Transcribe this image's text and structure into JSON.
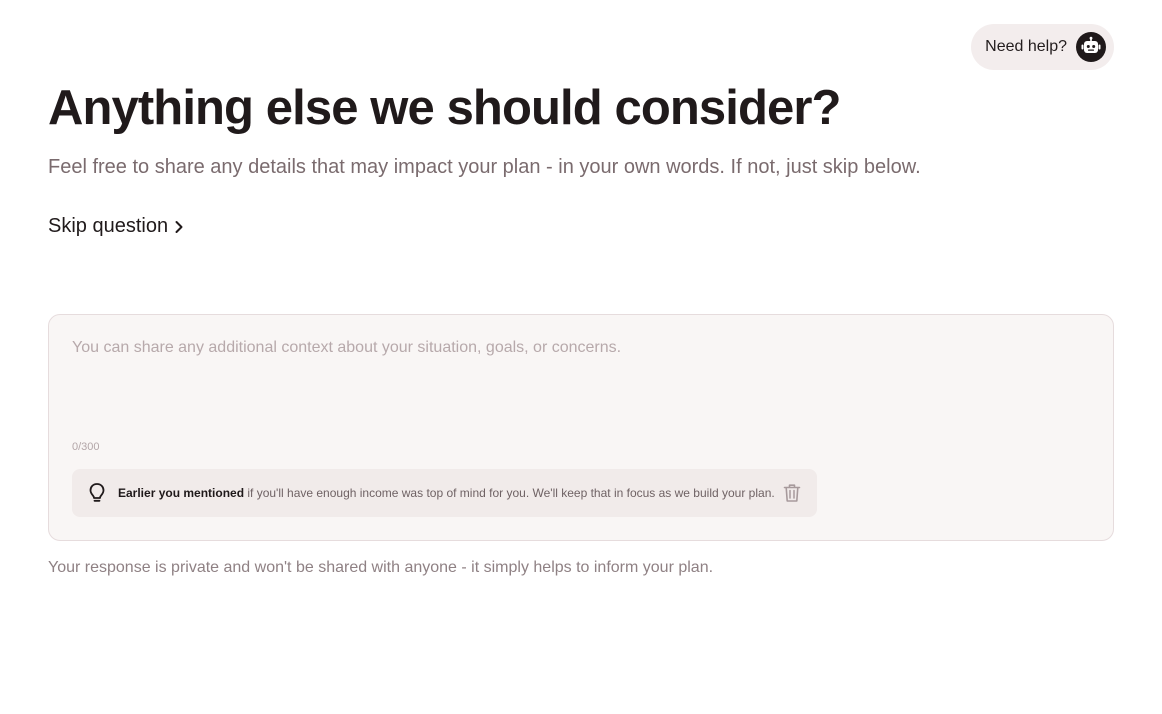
{
  "help": {
    "label": "Need help?",
    "icon": "robot-icon"
  },
  "question": {
    "title": "Anything else we should consider?",
    "subtitle": "Feel free to share any details that may impact your plan - in your own words. If not, just skip below."
  },
  "skip": {
    "label": "Skip question",
    "icon": "chevron-right-icon"
  },
  "response": {
    "value": "",
    "placeholder": "You can share any additional context about your situation, goals, or concerns.",
    "counter": "0/300"
  },
  "mention": {
    "icon": "lightbulb-icon",
    "prefix": "Earlier you mentioned",
    "text": "if you'll have enough income was top of mind for you. We'll keep that in focus as we build your plan.",
    "delete_icon": "trash-icon"
  },
  "privacy_note": "Your response is private and won't be shared with anyone - it simply helps to inform your plan.",
  "colors": {
    "text_primary": "#201a1b",
    "text_muted": "#7a6b6e",
    "card_background": "#f9f6f5",
    "pill_background": "#f3eded"
  }
}
